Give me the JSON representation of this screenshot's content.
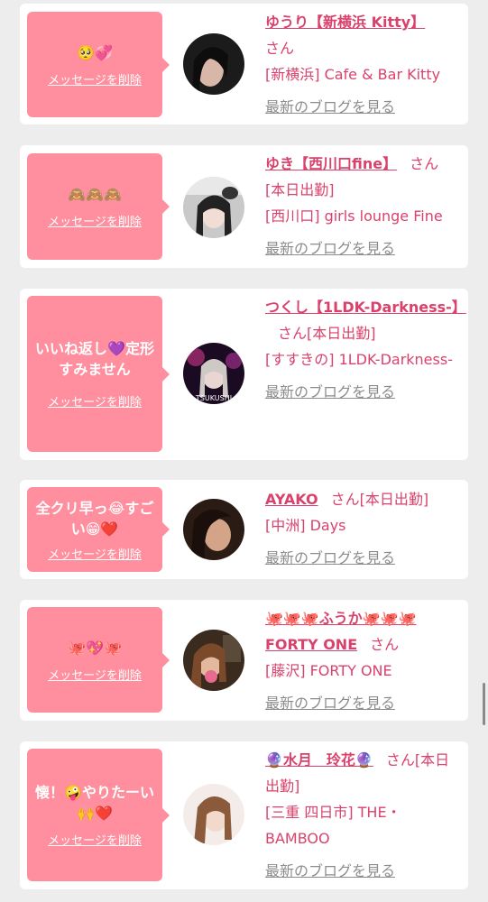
{
  "colors": {
    "page_background": "#ededed",
    "card_background": "#ffffff",
    "bubble": "#ff8f9e",
    "accent_text": "#d9426d",
    "link_gray": "#8c8c8c"
  },
  "cards": [
    {
      "message": "🥺💞",
      "delete_label": "メッセージを削除",
      "name": "ゆうり【新横浜 Kitty】",
      "suffix": "さん",
      "shop": "[新横浜] Cafe & Bar Kitty",
      "blog_label": "最新のブログを見る",
      "avatar_icon": "avatar-photo-icon"
    },
    {
      "message": "🙈🙈🙈",
      "delete_label": "メッセージを削除",
      "name": "ゆき【西川口fine】",
      "suffix": "さん",
      "shop": "[本日出勤]",
      "shop2": "[西川口] girls lounge Fine",
      "blog_label": "最新のブログを見る",
      "avatar_icon": "avatar-photo-icon"
    },
    {
      "message": "いいね返し💜定形すみません",
      "delete_label": "メッセージを削除",
      "name": "つくし【1LDK-Darkness-】",
      "suffix": "さん[本日出勤]",
      "shop": "[すすきの] 1LDK-Darkness-",
      "blog_label": "最新のブログを見る",
      "avatar_caption": "TSUKUSHI",
      "avatar_icon": "avatar-photo-icon"
    },
    {
      "message": "全クリ早っ😂すごい😁❤️",
      "delete_label": "メッセージを削除",
      "name": "AYAKO",
      "suffix": "さん[本日出勤]",
      "shop": "[中洲] Days",
      "blog_label": "最新のブログを見る",
      "avatar_icon": "avatar-photo-icon"
    },
    {
      "message": "🐙💖🐙",
      "delete_label": "メッセージを削除",
      "name": "🐙🐙🐙ふうか🐙🐙🐙 FORTY ONE",
      "suffix": "さん",
      "shop": "[藤沢] FORTY ONE",
      "blog_label": "最新のブログを見る",
      "avatar_icon": "avatar-photo-icon"
    },
    {
      "message": "懐！🤪やりたーい🙌❤️",
      "delete_label": "メッセージを削除",
      "name": "🔮水月　玲花🔮",
      "suffix": "さん[本日出勤]",
      "shop": "[三重 四日市] THE・BAMBOO",
      "blog_label": "最新のブログを見る",
      "avatar_icon": "avatar-photo-icon"
    }
  ]
}
